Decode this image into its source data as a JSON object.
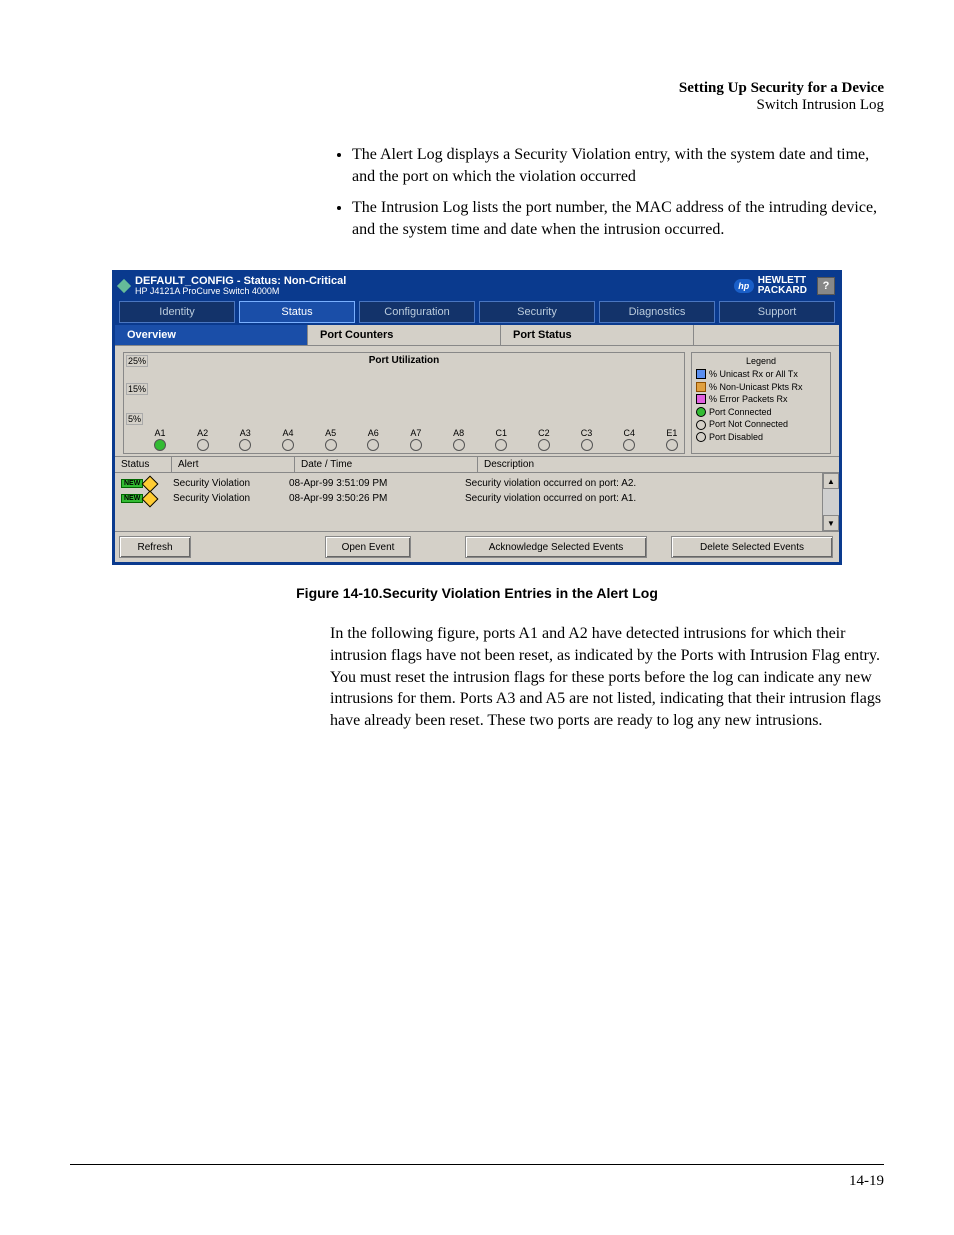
{
  "header": {
    "title": "Setting Up Security for a Device",
    "subtitle": "Switch Intrusion Log"
  },
  "bullets": [
    "The Alert Log displays a Security Violation entry, with the system date and time, and the port on which the violation occurred",
    "The Intrusion Log lists the port number, the MAC address of the intruding device, and the system time and date when the intrusion occurred."
  ],
  "screenshot": {
    "title_line1": "DEFAULT_CONFIG - Status: Non-Critical",
    "title_line2": "HP J4121A ProCurve Switch 4000M",
    "logo_text1": "HEWLETT",
    "logo_text2": "PACKARD",
    "help_label": "?",
    "nav": {
      "items": [
        "Identity",
        "Status",
        "Configuration",
        "Security",
        "Diagnostics",
        "Support"
      ],
      "active_index": 1
    },
    "subnav": {
      "items": [
        "Overview",
        "Port Counters",
        "Port Status"
      ],
      "active_index": 0
    },
    "chart": {
      "title": "Port Utilization",
      "y_ticks": [
        "25%",
        "15%",
        "5%"
      ],
      "legend_title": "Legend",
      "legend": [
        "% Unicast Rx or All Tx",
        "% Non-Unicast Pkts Rx",
        "% Error Packets Rx",
        "Port Connected",
        "Port Not Connected",
        "Port Disabled"
      ],
      "ports": [
        "A1",
        "A2",
        "A3",
        "A4",
        "A5",
        "A6",
        "A7",
        "A8",
        "C1",
        "C2",
        "C3",
        "C4",
        "E1"
      ],
      "green_index": 0
    },
    "alert_headers": {
      "status": "Status",
      "alert": "Alert",
      "datetime": "Date / Time",
      "description": "Description"
    },
    "alerts": [
      {
        "badge": "NEW",
        "alert": "Security Violation",
        "datetime": "08-Apr-99 3:51:09 PM",
        "description": "Security violation occurred on port: A2."
      },
      {
        "badge": "NEW",
        "alert": "Security Violation",
        "datetime": "08-Apr-99 3:50:26 PM",
        "description": "Security violation occurred on port: A1."
      }
    ],
    "buttons": {
      "refresh": "Refresh",
      "open_event": "Open Event",
      "ack": "Acknowledge Selected Events",
      "delete": "Delete Selected Events"
    }
  },
  "chart_data": {
    "type": "bar",
    "title": "Port Utilization",
    "categories": [
      "A1",
      "A2",
      "A3",
      "A4",
      "A5",
      "A6",
      "A7",
      "A8",
      "C1",
      "C2",
      "C3",
      "C4",
      "E1"
    ],
    "series": [
      {
        "name": "% Unicast Rx or All Tx",
        "values": [
          0,
          0,
          0,
          0,
          0,
          0,
          0,
          0,
          0,
          0,
          0,
          0,
          0
        ]
      },
      {
        "name": "% Non-Unicast Pkts Rx",
        "values": [
          0,
          0,
          0,
          0,
          0,
          0,
          0,
          0,
          0,
          0,
          0,
          0,
          0
        ]
      },
      {
        "name": "% Error Packets Rx",
        "values": [
          0,
          0,
          0,
          0,
          0,
          0,
          0,
          0,
          0,
          0,
          0,
          0,
          0
        ]
      }
    ],
    "port_status": [
      "connected",
      "not-connected",
      "not-connected",
      "not-connected",
      "not-connected",
      "not-connected",
      "not-connected",
      "not-connected",
      "not-connected",
      "not-connected",
      "not-connected",
      "not-connected",
      "not-connected"
    ],
    "ylabel": "%",
    "ylim": [
      0,
      25
    ],
    "y_ticks": [
      5,
      15,
      25
    ]
  },
  "figure_caption": "Figure 14-10.Security Violation Entries in the Alert Log",
  "body_paragraph": "In the following figure, ports A1 and A2 have detected intrusions for which their intrusion flags have not been reset, as indicated by the Ports with Intrusion Flag entry. You must reset the intrusion flags for these ports before the log can indicate any new intrusions for them. Ports A3 and A5 are not listed, indicating that their intrusion flags have already been reset. These two ports are ready to log any new intrusions.",
  "page_number": "14-19"
}
